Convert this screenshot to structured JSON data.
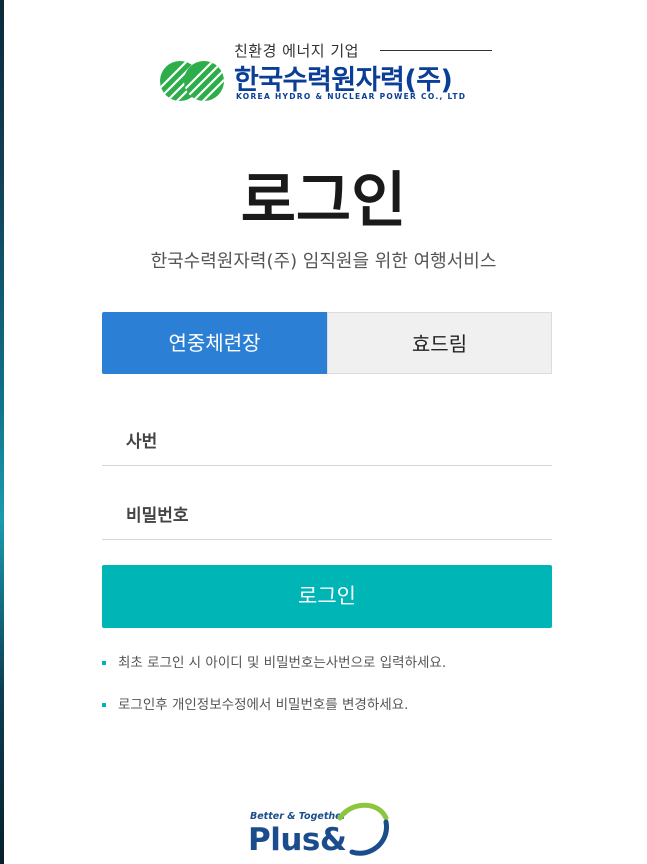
{
  "brand": {
    "tagline": "친환경 에너지 기업",
    "name": "한국수력원자력(주)",
    "english_name": "KOREA HYDRO & NUCLEAR POWER CO., LTD",
    "logo_icon": "khnp-green-striped-circle-logo",
    "primary_color": "#0b3e96",
    "logo_color": "#2eae4a"
  },
  "title": "로그인",
  "subtitle": "한국수력원자력(주) 임직원을 위한 여행서비스",
  "tabs": [
    {
      "label": "연중체련장",
      "active": true
    },
    {
      "label": "효드림",
      "active": false
    }
  ],
  "form": {
    "employee_id": {
      "placeholder": "사번",
      "value": ""
    },
    "password": {
      "placeholder": "비밀번호",
      "value": ""
    },
    "submit_label": "로그인"
  },
  "notes": [
    "최초 로그인 시 아이디 및 비밀번호는사번으로 입력하세요.",
    "로그인후 개인정보수정에서 비밀번호를 변경하세요."
  ],
  "footer_logo": {
    "tagline": "Better & Together",
    "word": "Plus&",
    "icon": "plus-and-swoosh-logo"
  },
  "colors": {
    "tab_active": "#2b7fd4",
    "tab_inactive": "#f0f0f0",
    "accent": "#00b5b5"
  }
}
